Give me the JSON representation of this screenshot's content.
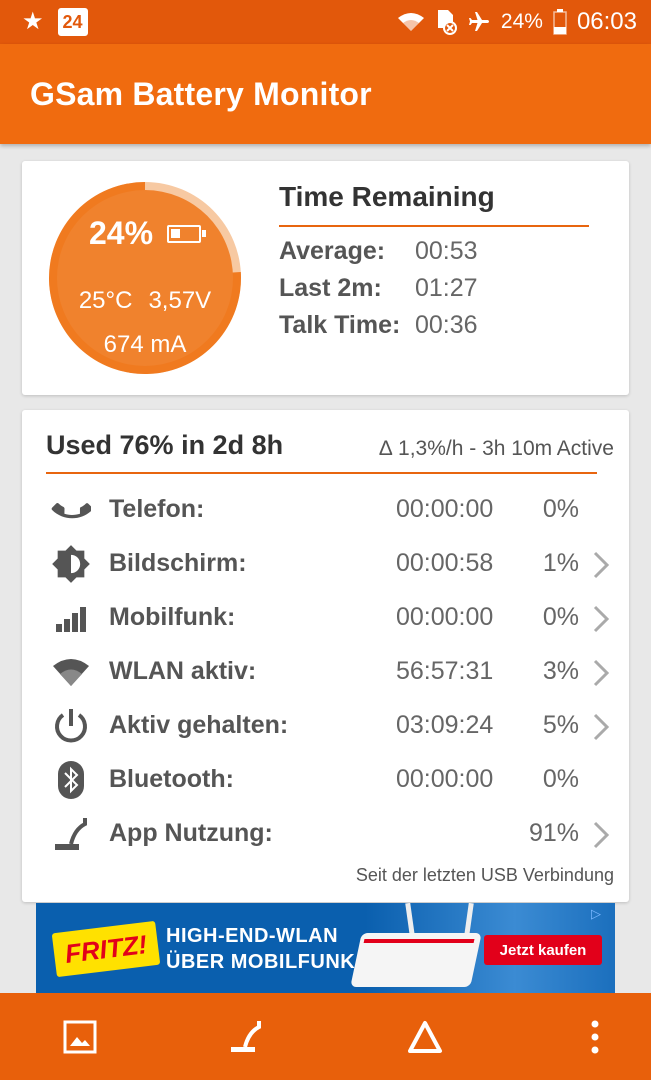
{
  "status_bar": {
    "calendar_day": "24",
    "battery_text": "24%",
    "time": "06:03",
    "icons": [
      "star-icon",
      "calendar-icon",
      "wifi-icon",
      "sim-off-icon",
      "airplane-icon",
      "battery-icon"
    ]
  },
  "app_bar": {
    "title": "GSam Battery Monitor"
  },
  "battery_gauge": {
    "percent_text": "24%",
    "percent_value": 24,
    "temperature": "25°C",
    "voltage": "3,57V",
    "current": "674 mA",
    "color": "#f0822d"
  },
  "time_remaining": {
    "title": "Time Remaining",
    "rows": [
      {
        "label": "Average:",
        "value": "00:53"
      },
      {
        "label": "Last 2m:",
        "value": "01:27"
      },
      {
        "label": "Talk Time:",
        "value": "00:36"
      }
    ]
  },
  "usage": {
    "title": "Used 76% in 2d 8h",
    "rate": "∆ 1,3%/h - 3h 10m Active",
    "rows": [
      {
        "icon": "phone-icon",
        "label": "Telefon:",
        "time": "00:00:00",
        "percent": "0%",
        "chevron": false
      },
      {
        "icon": "brightness-icon",
        "label": "Bildschirm:",
        "time": "00:00:58",
        "percent": "1%",
        "chevron": true
      },
      {
        "icon": "signal-icon",
        "label": "Mobilfunk:",
        "time": "00:00:00",
        "percent": "0%",
        "chevron": true
      },
      {
        "icon": "wifi-icon",
        "label": "WLAN aktiv:",
        "time": "56:57:31",
        "percent": "3%",
        "chevron": true
      },
      {
        "icon": "power-icon",
        "label": "Aktiv gehalten:",
        "time": "03:09:24",
        "percent": "5%",
        "chevron": true
      },
      {
        "icon": "bluetooth-icon",
        "label": "Bluetooth:",
        "time": "00:00:00",
        "percent": "0%",
        "chevron": false
      },
      {
        "icon": "app-usage-icon",
        "label": "App Nutzung:",
        "time": "",
        "percent": "91%",
        "chevron": true
      }
    ],
    "footnote": "Seit der letzten USB Verbindung"
  },
  "ad": {
    "logo": "FRITZ!",
    "line1": "HIGH-END-WLAN",
    "line2": "ÜBER MOBILFUNK",
    "cta": "Jetzt kaufen"
  },
  "bottom_bar": {
    "icons": [
      "image-icon",
      "app-usage-icon",
      "delta-icon",
      "more-vert-icon"
    ]
  },
  "colors": {
    "accent": "#f06b0f",
    "status_bar": "#e2580b",
    "bottom_bar": "#e8600b"
  }
}
